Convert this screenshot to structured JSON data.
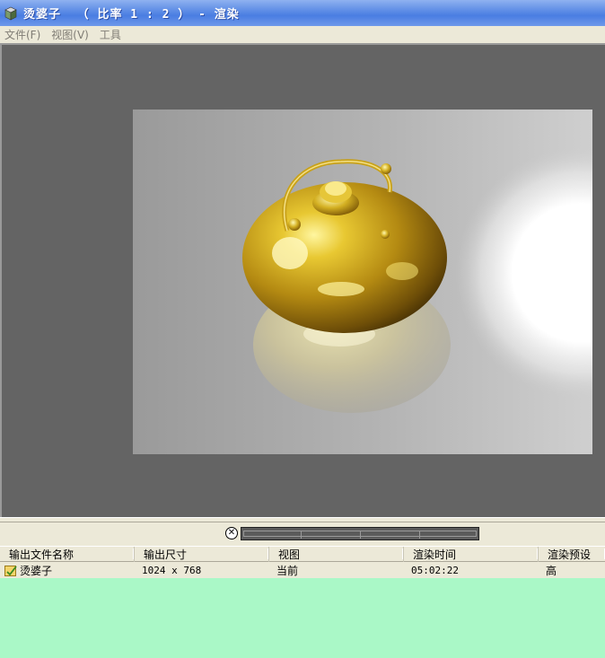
{
  "window": {
    "title": "烫婆子  （ 比率 1 : 2 ） - 渲染"
  },
  "menu": {
    "items": [
      {
        "label": "文件(F)"
      },
      {
        "label": "视图(V)"
      },
      {
        "label": "工具"
      }
    ]
  },
  "colors": {
    "list_background": "#aaf8c7",
    "viewport_background": "#646464",
    "titlebar_blue": "#4a7de2"
  },
  "progress": {
    "cancel_icon": "cancel-icon",
    "fraction": 0
  },
  "render_list": {
    "columns": [
      {
        "label": "输出文件名称"
      },
      {
        "label": "输出尺寸"
      },
      {
        "label": "视图"
      },
      {
        "label": "渲染时间"
      },
      {
        "label": "渲染预设"
      }
    ],
    "rows": [
      {
        "icon": "render-file-icon",
        "name": "烫婆子",
        "size": "1024 x 768",
        "view": "当前",
        "time": "05:02:22",
        "preset": "高"
      }
    ]
  }
}
